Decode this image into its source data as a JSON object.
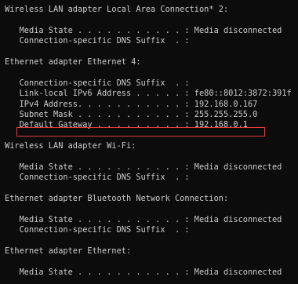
{
  "terminal": {
    "lines": [
      "Wireless LAN adapter Local Area Connection* 2:",
      "",
      "   Media State . . . . . . . . . . . : Media disconnected",
      "   Connection-specific DNS Suffix  . :",
      "",
      "Ethernet adapter Ethernet 4:",
      "",
      "   Connection-specific DNS Suffix  . :",
      "   Link-local IPv6 Address . . . . . : fe80::8012:3872:391f",
      "   IPv4 Address. . . . . . . . . . . : 192.168.0.167",
      "   Subnet Mask . . . . . . . . . . . : 255.255.255.0",
      "   Default Gateway . . . . . . . . . : 192.168.0.1",
      "",
      "Wireless LAN adapter Wi-Fi:",
      "",
      "   Media State . . . . . . . . . . . : Media disconnected",
      "   Connection-specific DNS Suffix  . :",
      "",
      "Ethernet adapter Bluetooth Network Connection:",
      "",
      "   Media State . . . . . . . . . . . : Media disconnected",
      "   Connection-specific DNS Suffix  . :",
      "",
      "Ethernet adapter Ethernet:",
      "",
      "   Media State . . . . . . . . . . . : Media disconnected"
    ]
  },
  "colors": {
    "background": "#0c0c0c",
    "text": "#cccccc",
    "highlight": "#e23b3b"
  }
}
